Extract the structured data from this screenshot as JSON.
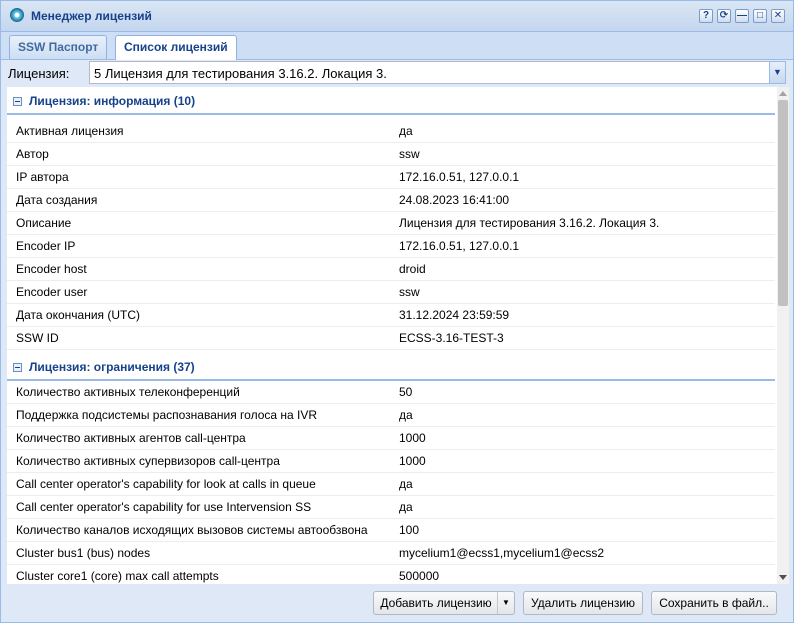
{
  "window": {
    "title": "Менеджер лицензий",
    "tool_buttons": [
      "?",
      "⟳",
      "—",
      "□",
      "✕"
    ]
  },
  "tabs": [
    {
      "label": "SSW Паспорт",
      "active": false
    },
    {
      "label": "Список лицензий",
      "active": true
    }
  ],
  "license_select": {
    "label": "Лицензия:",
    "value": "5 Лицензия для тестирования 3.16.2. Локация 3."
  },
  "groups": [
    {
      "title": "Лицензия: информация (10)",
      "rows": [
        {
          "name": "Активная лицензия",
          "value": "да"
        },
        {
          "name": "Автор",
          "value": "ssw"
        },
        {
          "name": "IP автора",
          "value": "172.16.0.51, 127.0.0.1"
        },
        {
          "name": "Дата создания",
          "value": "24.08.2023 16:41:00"
        },
        {
          "name": "Описание",
          "value": "Лицензия для тестирования 3.16.2. Локация 3."
        },
        {
          "name": "Encoder IP",
          "value": "172.16.0.51, 127.0.0.1"
        },
        {
          "name": "Encoder host",
          "value": "droid"
        },
        {
          "name": "Encoder user",
          "value": "ssw"
        },
        {
          "name": "Дата окончания (UTC)",
          "value": "31.12.2024 23:59:59"
        },
        {
          "name": "SSW ID",
          "value": "ECSS-3.16-TEST-3"
        }
      ]
    },
    {
      "title": "Лицензия: ограничения (37)",
      "rows": [
        {
          "name": "Количество активных телеконференций",
          "value": "50"
        },
        {
          "name": "Поддержка подсистемы распознавания голоса на IVR",
          "value": "да"
        },
        {
          "name": "Количество активных агентов call-центра",
          "value": "1000"
        },
        {
          "name": "Количество активных супервизоров call-центра",
          "value": "1000"
        },
        {
          "name": "Call center operator's capability for look at calls in queue",
          "value": "да"
        },
        {
          "name": "Call center operator's capability for use Intervension SS",
          "value": "да"
        },
        {
          "name": "Количество каналов исходящих вызовов системы автообзвона",
          "value": "100"
        },
        {
          "name": "Cluster bus1 (bus) nodes",
          "value": "mycelium1@ecss1,mycelium1@ecss2"
        },
        {
          "name": "Cluster core1 (core) max call attempts",
          "value": "500000"
        }
      ]
    }
  ],
  "footer": {
    "add_label": "Добавить лицензию",
    "delete_label": "Удалить лицензию",
    "save_label": "Сохранить в файл.."
  },
  "icons": {
    "app": "app-icon",
    "collapse": "collapse-icon",
    "dropdown": "chevron-down-icon"
  },
  "colors": {
    "accent": "#15428b",
    "border": "#99bbe8",
    "panel": "#dfe8f6"
  }
}
